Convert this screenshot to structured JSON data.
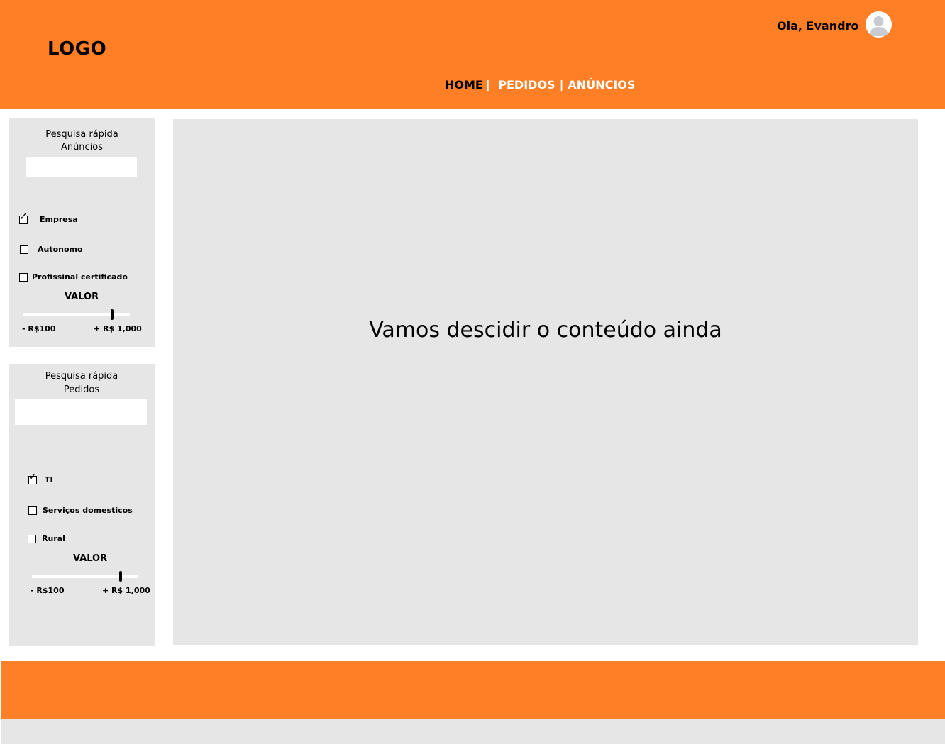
{
  "header": {
    "logo": "LOGO",
    "greeting": "Ola, Evandro",
    "avatar_icon": "user-avatar-icon",
    "nav": {
      "home": "HOME",
      "separator": "|",
      "pedidos": "PEDIDOS",
      "anuncios": "ANÚNCIOS"
    }
  },
  "sidebar": {
    "anuncios_panel": {
      "title_line1": "Pesquisa rápida",
      "title_line2": "Anúncios",
      "search_value": "",
      "checkboxes": [
        {
          "label": "Empresa",
          "checked": true
        },
        {
          "label": "Autonomo",
          "checked": false
        },
        {
          "label": "Profissinal certificado",
          "checked": false
        }
      ],
      "valor_label": "VALOR",
      "range_min_label": "- R$100",
      "range_max_label": "+ R$ 1,000",
      "slider_level": 0.84
    },
    "pedidos_panel": {
      "title_line1": "Pesquisa rápida",
      "title_line2": "Pedidos",
      "search_value": "",
      "checkboxes": [
        {
          "label": "TI",
          "checked": true
        },
        {
          "label": "Serviços domesticos",
          "checked": false
        },
        {
          "label": "Rural",
          "checked": false
        }
      ],
      "valor_label": "VALOR",
      "range_min_label": "- R$100",
      "range_max_label": "+ R$ 1,000",
      "slider_level": 0.84
    }
  },
  "main": {
    "placeholder_text": "Vamos descidir o conteúdo ainda"
  },
  "colors": {
    "accent_orange": "#ff7f27",
    "panel_gray": "#e6e6e6"
  }
}
